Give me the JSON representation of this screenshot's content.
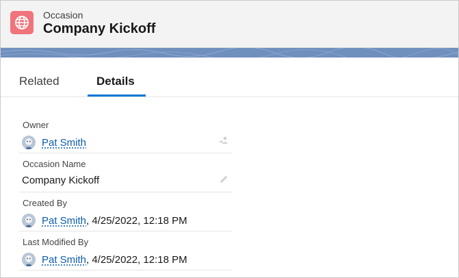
{
  "header": {
    "object_label": "Occasion",
    "record_title": "Company Kickoff",
    "icon": "globe-icon",
    "icon_color": "#f0747b"
  },
  "banner": {
    "color": "#6f8fbd"
  },
  "tabs": [
    {
      "label": "Related",
      "active": false
    },
    {
      "label": "Details",
      "active": true
    }
  ],
  "accent_color": "#0176d3",
  "link_color": "#0b5cab",
  "fields": {
    "owner": {
      "label": "Owner",
      "user": "Pat Smith"
    },
    "occasion_name": {
      "label": "Occasion Name",
      "value": "Company Kickoff"
    },
    "created_by": {
      "label": "Created By",
      "user": "Pat Smith",
      "timestamp": ", 4/25/2022, 12:18 PM"
    },
    "last_modified_by": {
      "label": "Last Modified By",
      "user": "Pat Smith",
      "timestamp": ", 4/25/2022, 12:18 PM"
    }
  }
}
